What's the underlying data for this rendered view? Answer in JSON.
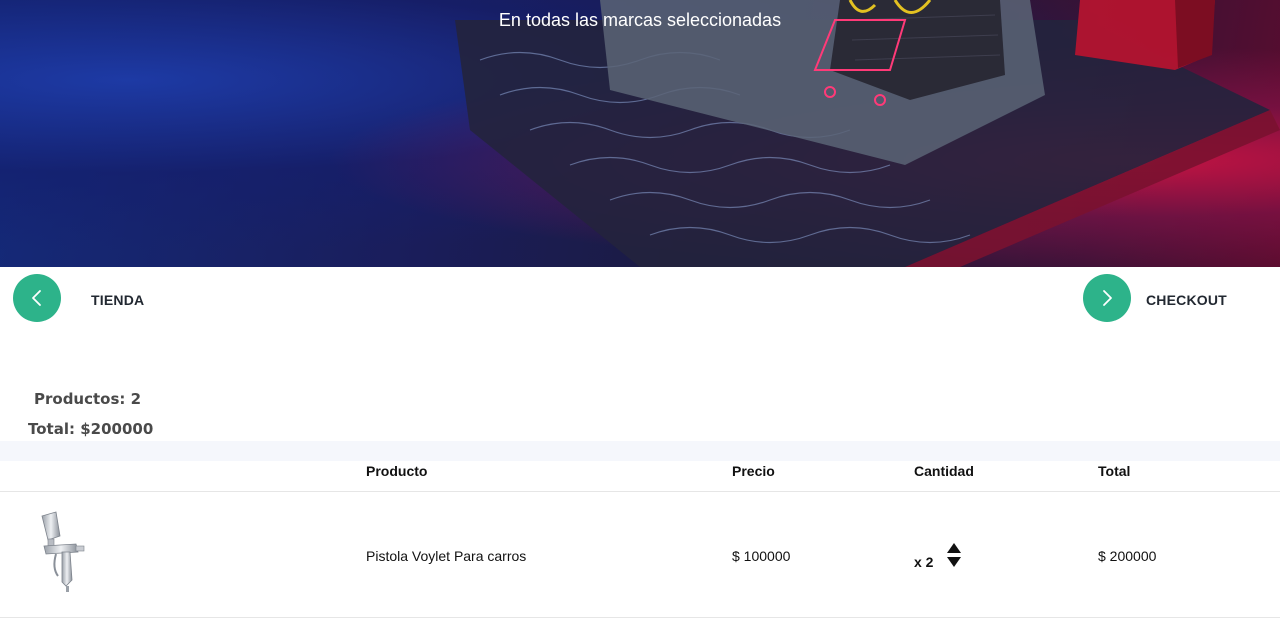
{
  "hero": {
    "subtitle": "En todas las marcas seleccionadas"
  },
  "nav": {
    "back_label": "TIENDA",
    "forward_label": "CHECKOUT",
    "back_icon": "chevron-left-icon",
    "forward_icon": "chevron-right-icon",
    "accent_color": "#2db38a"
  },
  "summary": {
    "products": "Productos: 2",
    "total": "Total: $200000"
  },
  "table": {
    "headers": [
      "Producto",
      "Precio",
      "Cantidad",
      "Total"
    ],
    "rows": [
      {
        "image_icon": "spray-gun-image",
        "product": "Pistola Voylet Para carros",
        "price": "$ 100000",
        "quantity": "x 2",
        "total": "$ 200000"
      }
    ]
  }
}
